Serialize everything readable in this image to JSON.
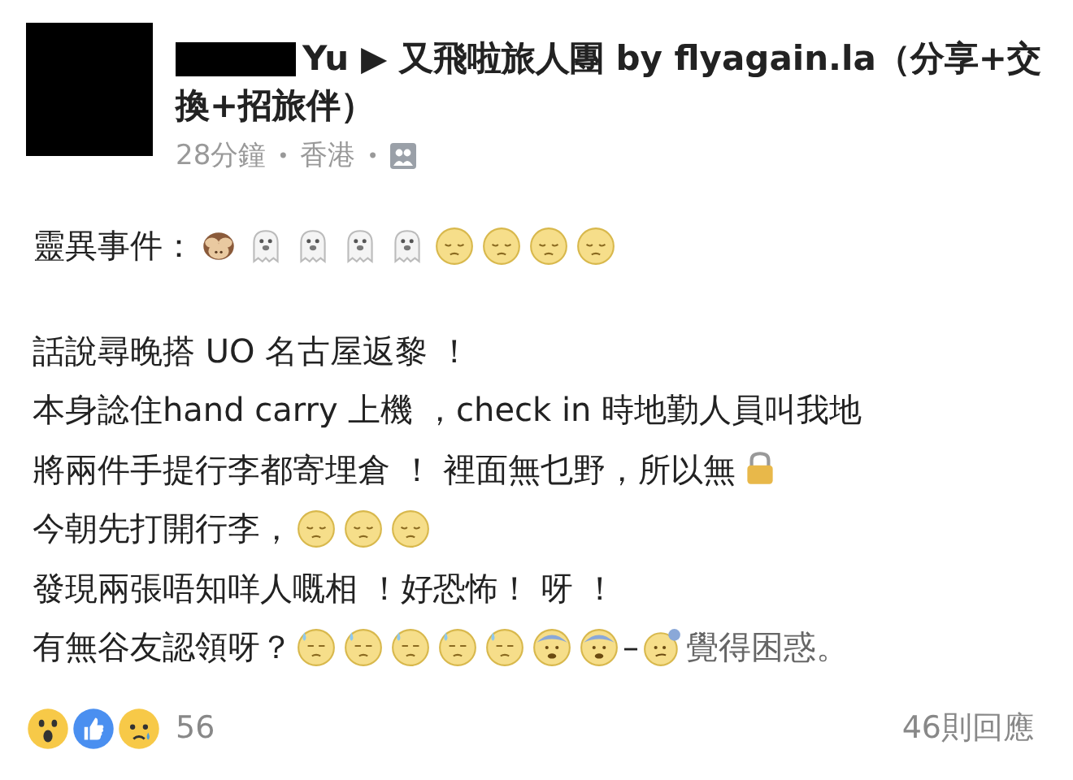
{
  "post": {
    "title": "Yu ▶ 又飛啦旅人團 by flyagain.la（分享+交換+招旅伴）",
    "time": "28分鐘",
    "separator": "•",
    "location": "香港",
    "lines": [
      [
        {
          "kind": "text",
          "text": "靈異事件："
        },
        {
          "kind": "monkey"
        },
        {
          "kind": "ghost"
        },
        {
          "kind": "ghost"
        },
        {
          "kind": "ghost"
        },
        {
          "kind": "ghost"
        },
        {
          "kind": "pensive"
        },
        {
          "kind": "pensive"
        },
        {
          "kind": "pensive"
        },
        {
          "kind": "pensive"
        }
      ],
      [
        {
          "kind": "gap"
        }
      ],
      [
        {
          "kind": "text",
          "text": "話說尋晚搭 UO 名古屋返黎 ！"
        }
      ],
      [
        {
          "kind": "text",
          "text": "本身諗住hand carry 上機 ，check in 時地勤人員叫我地"
        }
      ],
      [
        {
          "kind": "text",
          "text": "將兩件手提行李都寄埋倉 ！ 裡面無乜野，所以無"
        },
        {
          "kind": "lock"
        }
      ],
      [
        {
          "kind": "text",
          "text": "今朝先打開行李，"
        },
        {
          "kind": "pensive"
        },
        {
          "kind": "pensive"
        },
        {
          "kind": "pensive"
        }
      ],
      [
        {
          "kind": "text",
          "text": "發現兩張唔知咩人嘅相 ！好恐怖！ 呀 ！"
        }
      ],
      [
        {
          "kind": "text",
          "text": "有無谷友認領呀？ "
        },
        {
          "kind": "sweat"
        },
        {
          "kind": "sweat"
        },
        {
          "kind": "sweat"
        },
        {
          "kind": "sweat"
        },
        {
          "kind": "sweat"
        },
        {
          "kind": "anxious"
        },
        {
          "kind": "anxious"
        },
        {
          "kind": "text",
          "text": " – "
        },
        {
          "kind": "confused"
        },
        {
          "kind": "feeling",
          "text": "覺得困惑。"
        }
      ]
    ],
    "reaction_count": "56",
    "comments": "46則回應"
  }
}
